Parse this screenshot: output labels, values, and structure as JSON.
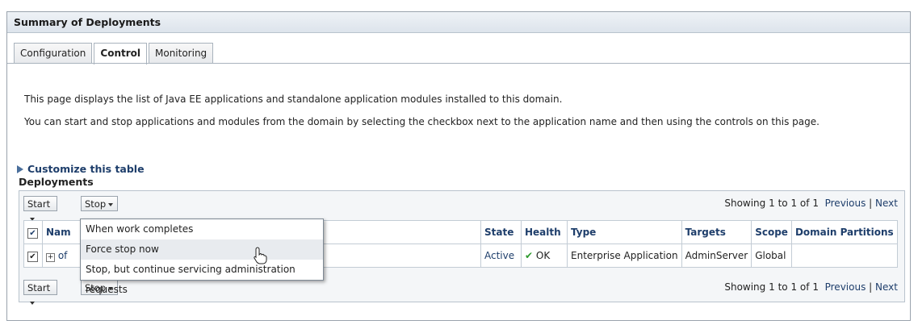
{
  "panel_title": "Summary of Deployments",
  "tabs": [
    {
      "label": "Configuration",
      "active": false
    },
    {
      "label": "Control",
      "active": true
    },
    {
      "label": "Monitoring",
      "active": false
    }
  ],
  "description": {
    "line1": "This page displays the list of Java EE applications and standalone application modules installed to this domain.",
    "line2": "You can start and stop applications and modules from the domain by selecting the checkbox next to the application name and then using the controls on this page."
  },
  "customize_link": "Customize this table",
  "deployments": {
    "title": "Deployments",
    "start_label": "Start",
    "stop_label": "Stop",
    "paging": {
      "prefix": "Showing",
      "from": "1",
      "to_word": "to",
      "to": "1",
      "of_word": "of",
      "total": "1",
      "previous": "Previous",
      "separator": "|",
      "next": "Next"
    },
    "columns": [
      "Nam",
      "State",
      "Health",
      "Type",
      "Targets",
      "Scope",
      "Domain Partitions"
    ],
    "rows": [
      {
        "checked": true,
        "name": "of",
        "state": "Active",
        "health": "OK",
        "type": "Enterprise Application",
        "targets": "AdminServer",
        "scope": "Global",
        "partitions": ""
      }
    ]
  },
  "stop_menu": {
    "items": [
      "When work completes",
      "Force stop now",
      "Stop, but continue servicing administration requests"
    ],
    "hovered_index": 1
  },
  "colors": {
    "link": "#1e3e6b",
    "ok_check": "#2e9a2e",
    "header_bg": "#dde4ec"
  }
}
